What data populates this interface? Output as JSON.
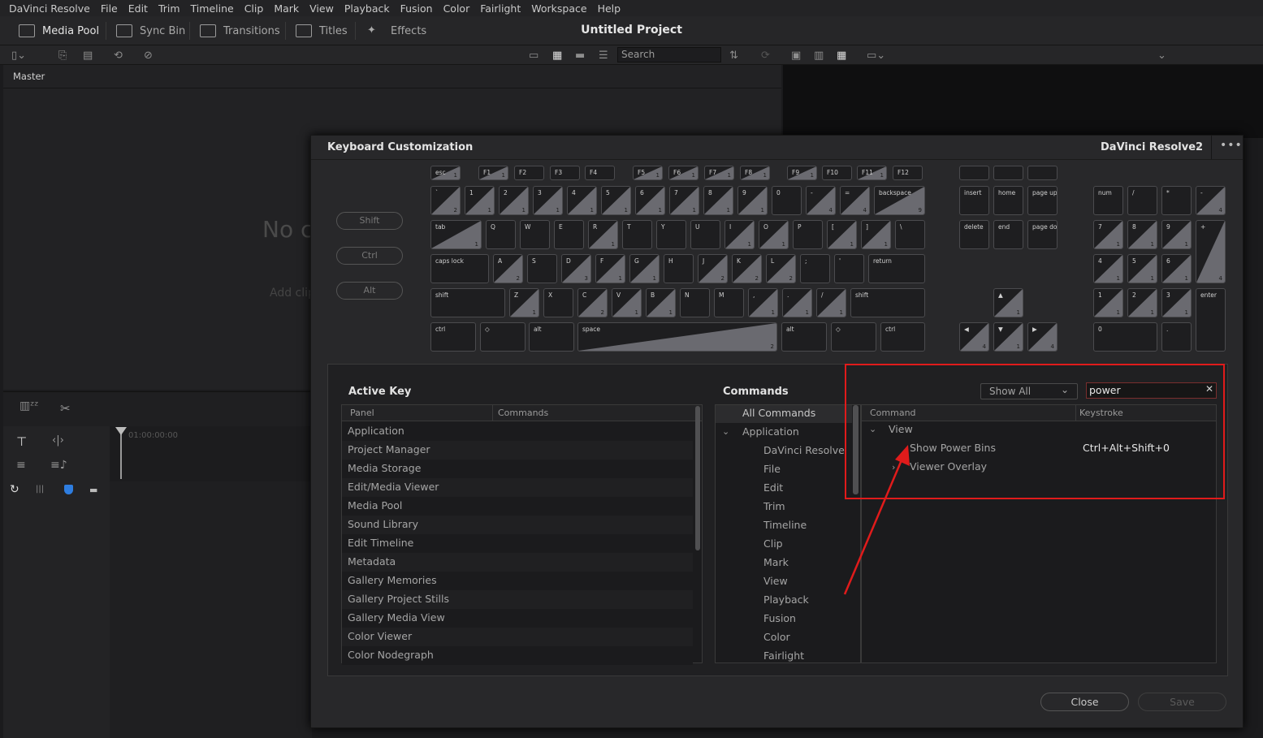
{
  "menubar": {
    "items": [
      "DaVinci Resolve",
      "File",
      "Edit",
      "Trim",
      "Timeline",
      "Clip",
      "Mark",
      "View",
      "Playback",
      "Fusion",
      "Color",
      "Fairlight",
      "Workspace",
      "Help"
    ]
  },
  "toolbar": {
    "media_pool": "Media Pool",
    "sync_bin": "Sync Bin",
    "transitions": "Transitions",
    "titles": "Titles",
    "effects": "Effects",
    "project_title": "Untitled Project"
  },
  "subbar": {
    "search_placeholder": "Search"
  },
  "media_pool": {
    "master": "Master",
    "empty_title": "No c",
    "empty_hint": "Add clip"
  },
  "timeline": {
    "timecode": "01:00:00:00"
  },
  "dialog": {
    "title": "Keyboard Customization",
    "preset": "DaVinci Resolve2",
    "more": "•••",
    "modifiers": [
      "Shift",
      "Ctrl",
      "Alt"
    ],
    "active_key": {
      "title": "Active Key",
      "col_panel": "Panel",
      "col_commands": "Commands",
      "panels": [
        "Application",
        "Project Manager",
        "Media Storage",
        "Edit/Media Viewer",
        "Media Pool",
        "Sound Library",
        "Edit Timeline",
        "Metadata",
        "Gallery Memories",
        "Gallery Project Stills",
        "Gallery Media View",
        "Color Viewer",
        "Color Nodegraph"
      ]
    },
    "commands": {
      "title": "Commands",
      "filter": "Show All",
      "search_value": "power",
      "tree_all": "All Commands",
      "tree_app": "Application",
      "tree_items": [
        "DaVinci Resolve",
        "File",
        "Edit",
        "Trim",
        "Timeline",
        "Clip",
        "Mark",
        "View",
        "Playback",
        "Fusion",
        "Color",
        "Fairlight"
      ],
      "col_command": "Command",
      "col_keystroke": "Keystroke",
      "group": "View",
      "results": [
        {
          "command": "Show Power Bins",
          "keystroke": "Ctrl+Alt+Shift+0"
        },
        {
          "command": "Viewer Overlay",
          "keystroke": ""
        }
      ]
    },
    "close": "Close",
    "save": "Save"
  },
  "keyboard": {
    "keys": [
      {
        "l": "esc",
        "c": "1"
      },
      {
        "l": "F1",
        "c": "1"
      },
      {
        "l": "F2",
        "c": ""
      },
      {
        "l": "F3",
        "c": ""
      },
      {
        "l": "F4",
        "c": ""
      },
      {
        "l": "F5",
        "c": "1"
      },
      {
        "l": "F6",
        "c": "1"
      },
      {
        "l": "F7",
        "c": "1"
      },
      {
        "l": "F8",
        "c": "1"
      },
      {
        "l": "F9",
        "c": "1"
      },
      {
        "l": "F10",
        "c": ""
      },
      {
        "l": "F11",
        "c": "1"
      },
      {
        "l": "F12",
        "c": ""
      },
      {
        "l": "",
        "c": ""
      },
      {
        "l": "",
        "c": ""
      },
      {
        "l": "",
        "c": ""
      },
      {
        "l": "`",
        "c": "2"
      },
      {
        "l": "1",
        "c": "1"
      },
      {
        "l": "2",
        "c": "1"
      },
      {
        "l": "3",
        "c": "1"
      },
      {
        "l": "4",
        "c": "1"
      },
      {
        "l": "5",
        "c": "1"
      },
      {
        "l": "6",
        "c": "1"
      },
      {
        "l": "7",
        "c": "1"
      },
      {
        "l": "8",
        "c": "1"
      },
      {
        "l": "9",
        "c": "1"
      },
      {
        "l": "0",
        "c": ""
      },
      {
        "l": "-",
        "c": "4"
      },
      {
        "l": "=",
        "c": "4"
      },
      {
        "l": "backspace",
        "c": "9"
      },
      {
        "l": "insert",
        "c": ""
      },
      {
        "l": "home",
        "c": ""
      },
      {
        "l": "page up",
        "c": ""
      },
      {
        "l": "num",
        "c": ""
      },
      {
        "l": "/",
        "c": ""
      },
      {
        "l": "*",
        "c": ""
      },
      {
        "l": "-",
        "c": "4"
      },
      {
        "l": "tab",
        "c": "1"
      },
      {
        "l": "Q",
        "c": ""
      },
      {
        "l": "W",
        "c": ""
      },
      {
        "l": "E",
        "c": ""
      },
      {
        "l": "R",
        "c": "1"
      },
      {
        "l": "T",
        "c": ""
      },
      {
        "l": "Y",
        "c": ""
      },
      {
        "l": "U",
        "c": ""
      },
      {
        "l": "I",
        "c": "1"
      },
      {
        "l": "O",
        "c": "1"
      },
      {
        "l": "P",
        "c": ""
      },
      {
        "l": "[",
        "c": "1"
      },
      {
        "l": "]",
        "c": "1"
      },
      {
        "l": "\\",
        "c": ""
      },
      {
        "l": "delete",
        "c": ""
      },
      {
        "l": "end",
        "c": ""
      },
      {
        "l": "page down",
        "c": ""
      },
      {
        "l": "7",
        "c": "1"
      },
      {
        "l": "8",
        "c": "1"
      },
      {
        "l": "9",
        "c": "1"
      },
      {
        "l": "+",
        "c": "4"
      },
      {
        "l": "caps lock",
        "c": ""
      },
      {
        "l": "A",
        "c": "2"
      },
      {
        "l": "S",
        "c": ""
      },
      {
        "l": "D",
        "c": "3"
      },
      {
        "l": "F",
        "c": "1"
      },
      {
        "l": "G",
        "c": "1"
      },
      {
        "l": "H",
        "c": ""
      },
      {
        "l": "J",
        "c": "2"
      },
      {
        "l": "K",
        "c": "2"
      },
      {
        "l": "L",
        "c": "2"
      },
      {
        "l": ";",
        "c": ""
      },
      {
        "l": "'",
        "c": ""
      },
      {
        "l": "return",
        "c": ""
      },
      {
        "l": "4",
        "c": "1"
      },
      {
        "l": "5",
        "c": "1"
      },
      {
        "l": "6",
        "c": "1"
      },
      {
        "l": "shift",
        "c": ""
      },
      {
        "l": "Z",
        "c": "1"
      },
      {
        "l": "X",
        "c": ""
      },
      {
        "l": "C",
        "c": "2"
      },
      {
        "l": "V",
        "c": "1"
      },
      {
        "l": "B",
        "c": "1"
      },
      {
        "l": "N",
        "c": ""
      },
      {
        "l": "M",
        "c": ""
      },
      {
        "l": ",",
        "c": "1"
      },
      {
        "l": ".",
        "c": "1"
      },
      {
        "l": "/",
        "c": "1"
      },
      {
        "l": "shift",
        "c": ""
      },
      {
        "l": "▲",
        "c": "1"
      },
      {
        "l": "1",
        "c": "1"
      },
      {
        "l": "2",
        "c": "1"
      },
      {
        "l": "3",
        "c": "1"
      },
      {
        "l": "enter",
        "c": ""
      },
      {
        "l": "ctrl",
        "c": ""
      },
      {
        "l": "◇",
        "c": ""
      },
      {
        "l": "alt",
        "c": ""
      },
      {
        "l": "space",
        "c": "2"
      },
      {
        "l": "alt",
        "c": ""
      },
      {
        "l": "◇",
        "c": ""
      },
      {
        "l": "ctrl",
        "c": ""
      },
      {
        "l": "◀",
        "c": "4"
      },
      {
        "l": "▼",
        "c": "1"
      },
      {
        "l": "▶",
        "c": "4"
      },
      {
        "l": "0",
        "c": ""
      },
      {
        "l": ".",
        "c": ""
      }
    ]
  },
  "colors": {
    "accent_red": "#e01b1b",
    "key_assigned": "#6a6a70",
    "background": "#1b1b1d"
  }
}
